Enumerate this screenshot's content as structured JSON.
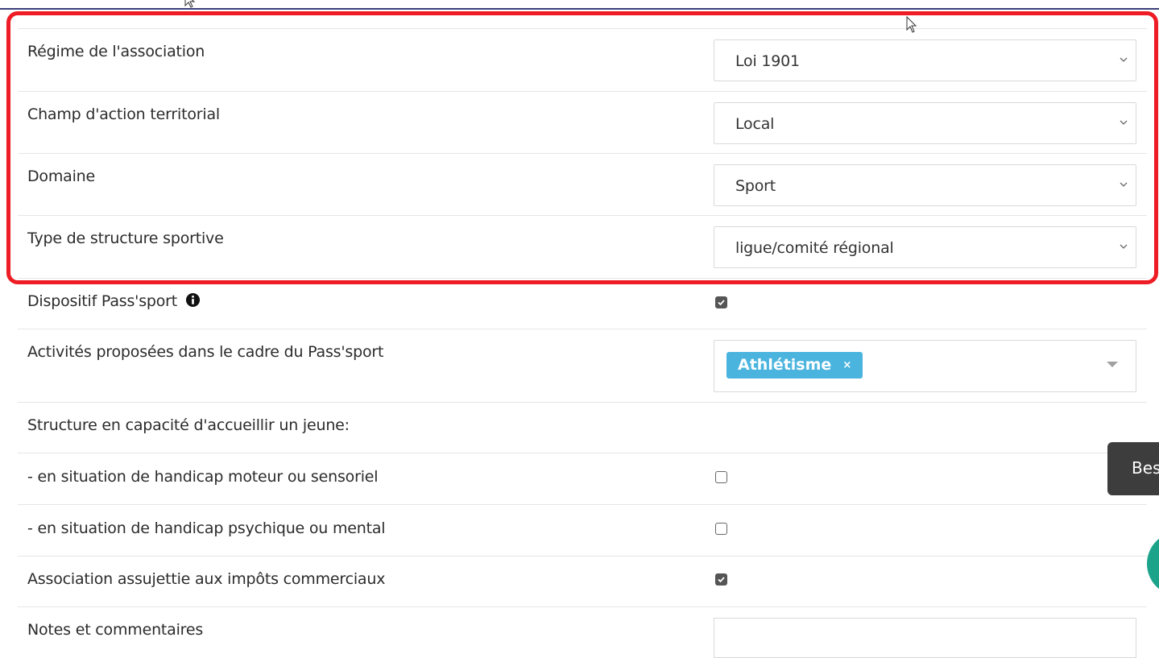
{
  "form": {
    "regime": {
      "label": "Régime de l'association",
      "value": "Loi 1901"
    },
    "champ": {
      "label": "Champ d'action territorial",
      "value": "Local"
    },
    "domaine": {
      "label": "Domaine",
      "value": "Sport"
    },
    "type_structure": {
      "label": "Type de structure sportive",
      "value": "ligue/comité régional"
    },
    "pass_sport": {
      "label": "Dispositif Pass'sport",
      "checked": true
    },
    "activites": {
      "label": "Activités proposées dans le cadre du Pass'sport",
      "tags": [
        "Athlétisme"
      ],
      "tag_remove": "×"
    },
    "accueil_header": {
      "label": "Structure en capacité d'accueillir un jeune:"
    },
    "handicap_moteur": {
      "label": "- en situation de handicap moteur ou sensoriel",
      "checked": false
    },
    "handicap_psychique": {
      "label": "- en situation de handicap psychique ou mental",
      "checked": false
    },
    "impots": {
      "label": "Association assujettie aux impôts commerciaux",
      "checked": true
    },
    "notes": {
      "label": "Notes et commentaires",
      "value": ""
    }
  },
  "overlay": {
    "tooltip_text": "Bes",
    "highlight_color": "#ee1c24",
    "tag_color": "#4bb4de"
  }
}
